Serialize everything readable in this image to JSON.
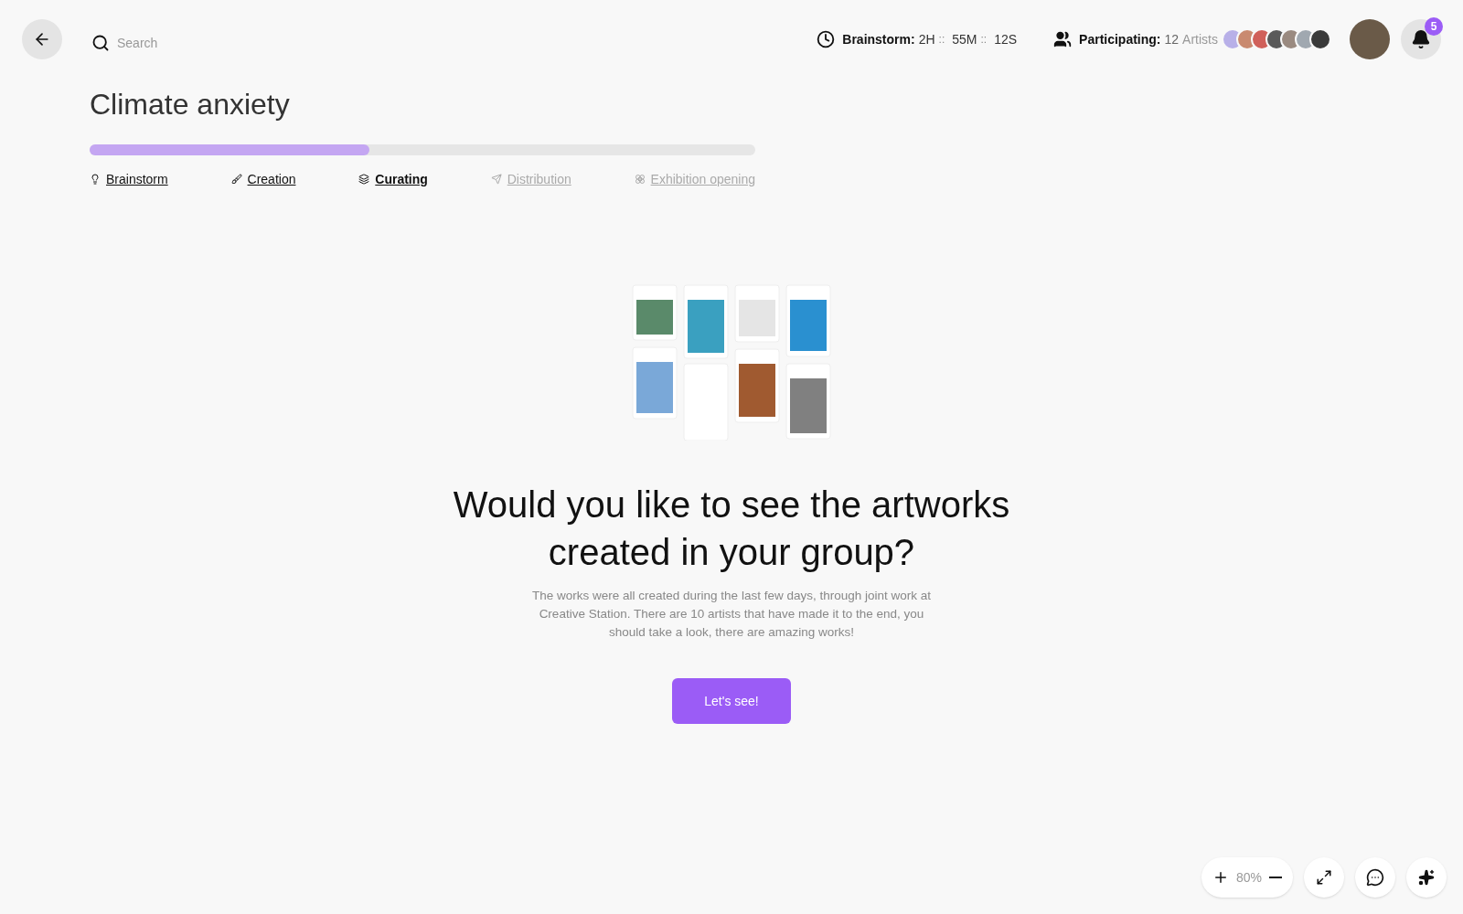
{
  "search": {
    "placeholder": "Search"
  },
  "timer": {
    "label": "Brainstorm:",
    "hours": "2H",
    "sep1": "::",
    "minutes": "55M",
    "sep2": "::",
    "seconds": "12S"
  },
  "participants": {
    "label": "Participating:",
    "count": "12",
    "unit": "Artists"
  },
  "notifications": {
    "badge": "5"
  },
  "title": "Climate anxiety",
  "progress": {
    "level": 0.42
  },
  "steps": [
    {
      "label": "Brainstorm",
      "kind": "bulb",
      "selected": false,
      "disabled": false
    },
    {
      "label": "Creation",
      "kind": "brush",
      "selected": false,
      "disabled": false
    },
    {
      "label": "Curating",
      "kind": "layers",
      "selected": true,
      "disabled": false
    },
    {
      "label": "Distribution",
      "kind": "send",
      "selected": false,
      "disabled": true
    },
    {
      "label": "Exhibition opening",
      "kind": "flower",
      "selected": false,
      "disabled": true
    }
  ],
  "heading": "Would you like to see the artworks created in your group?",
  "description": "The works were all created during the last few days, through joint work at Creative Station. There are 10 artists that have made it to the end, you should take a look, there are amazing works!",
  "cta": "Let's see!",
  "zoom": {
    "value": "80%"
  }
}
